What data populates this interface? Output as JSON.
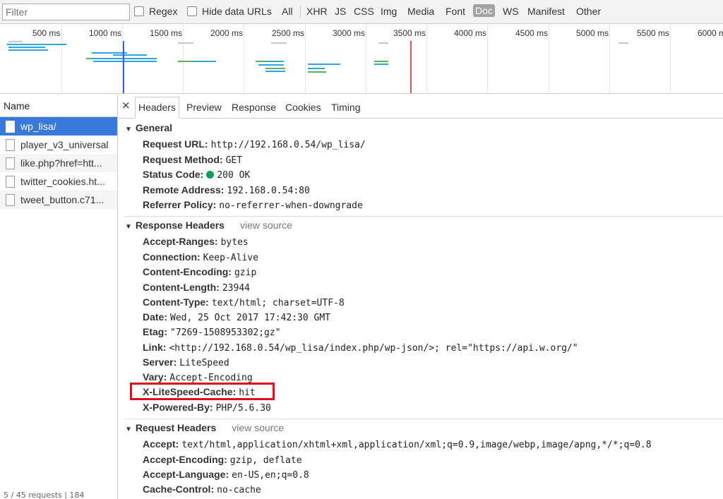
{
  "toolbar": {
    "filter_placeholder": "Filter",
    "regex_label": "Regex",
    "hide_data_urls_label": "Hide data URLs",
    "types": [
      "All",
      "XHR",
      "JS",
      "CSS",
      "Img",
      "Media",
      "Font",
      "Doc",
      "WS",
      "Manifest",
      "Other"
    ],
    "active_type": "Doc"
  },
  "overview": {
    "ticks": [
      "500 ms",
      "1000 ms",
      "1500 ms",
      "2000 ms",
      "2500 ms",
      "3000 ms",
      "3500 ms",
      "4000 ms",
      "4500 ms",
      "5000 ms",
      "5500 ms",
      "6000 m"
    ],
    "colors": {
      "waiting": "#2fa3e8",
      "receive": "#5ab54b",
      "queue": "#c8c8c8",
      "dom_line": "#3a5fdc",
      "load_line": "#e0505a"
    }
  },
  "names": {
    "header": "Name",
    "items": [
      "wp_lisa/",
      "player_v3_universal",
      "like.php?href=htt...",
      "twitter_cookies.ht...",
      "tweet_button.c71..."
    ],
    "selected_index": 0,
    "footer": "5 / 45 requests | 184"
  },
  "tabs": {
    "close_symbol": "×",
    "items": [
      "Headers",
      "Preview",
      "Response",
      "Cookies",
      "Timing"
    ],
    "active": "Headers"
  },
  "general": {
    "title": "General",
    "rows": [
      {
        "name": "Request URL:",
        "value": "http://192.168.0.54/wp_lisa/"
      },
      {
        "name": "Request Method:",
        "value": "GET"
      },
      {
        "name": "Status Code:",
        "value": "200 OK"
      },
      {
        "name": "Remote Address:",
        "value": "192.168.0.54:80"
      },
      {
        "name": "Referrer Policy:",
        "value": "no-referrer-when-downgrade"
      }
    ]
  },
  "response_headers": {
    "title": "Response Headers",
    "view_source": "view source",
    "rows": [
      {
        "name": "Accept-Ranges:",
        "value": "bytes"
      },
      {
        "name": "Connection:",
        "value": "Keep-Alive"
      },
      {
        "name": "Content-Encoding:",
        "value": "gzip"
      },
      {
        "name": "Content-Length:",
        "value": "23944"
      },
      {
        "name": "Content-Type:",
        "value": "text/html; charset=UTF-8"
      },
      {
        "name": "Date:",
        "value": "Wed, 25 Oct 2017 17:42:30 GMT"
      },
      {
        "name": "Etag:",
        "value": "\"7269-1508953302;gz\""
      },
      {
        "name": "Link:",
        "value": "<http://192.168.0.54/wp_lisa/index.php/wp-json/>; rel=\"https://api.w.org/\""
      },
      {
        "name": "Server:",
        "value": "LiteSpeed"
      },
      {
        "name": "Vary:",
        "value": "Accept-Encoding"
      },
      {
        "name": "X-LiteSpeed-Cache:",
        "value": "hit"
      },
      {
        "name": "X-Powered-By:",
        "value": "PHP/5.6.30"
      }
    ]
  },
  "request_headers": {
    "title": "Request Headers",
    "view_source": "view source",
    "rows": [
      {
        "name": "Accept:",
        "value": "text/html,application/xhtml+xml,application/xml;q=0.9,image/webp,image/apng,*/*;q=0.8"
      },
      {
        "name": "Accept-Encoding:",
        "value": "gzip, deflate"
      },
      {
        "name": "Accept-Language:",
        "value": "en-US,en;q=0.8"
      },
      {
        "name": "Cache-Control:",
        "value": "no-cache"
      }
    ]
  },
  "highlight_color": "#e0101a"
}
